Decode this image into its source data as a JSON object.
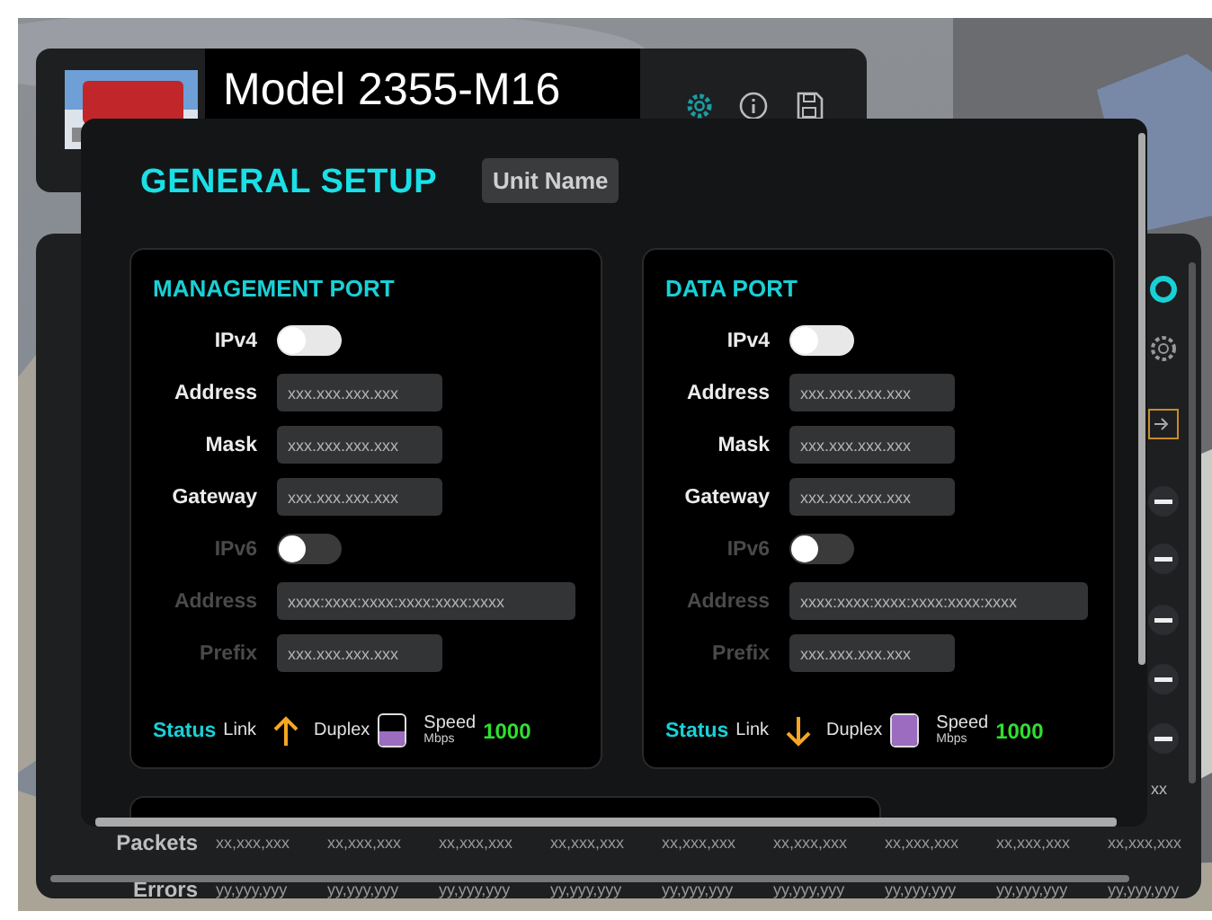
{
  "header": {
    "title": "Model 2355-M16"
  },
  "stats": {
    "rows": [
      {
        "label": "Packets",
        "values": [
          "xx,xxx,xxx",
          "xx,xxx,xxx",
          "xx,xxx,xxx",
          "xx,xxx,xxx",
          "xx,xxx,xxx",
          "xx,xxx,xxx",
          "xx,xxx,xxx",
          "xx,xxx,xxx",
          "xx,xxx,xxx"
        ]
      },
      {
        "label": "Errors",
        "values": [
          "yy,yyy,yyy",
          "yy,yyy,yyy",
          "yy,yyy,yyy",
          "yy,yyy,yyy",
          "yy,yyy,yyy",
          "yy,yyy,yyy",
          "yy,yyy,yyy",
          "yy,yyy,yyy",
          "yy,yyy,yyy"
        ]
      }
    ],
    "overflow_text": "xx"
  },
  "dialog": {
    "title": "GENERAL SETUP",
    "unit_name_button": "Unit Name",
    "ports": [
      {
        "title": "MANAGEMENT PORT",
        "rows": [
          {
            "kind": "toggle",
            "label": "IPv4",
            "on": false,
            "disabled": false
          },
          {
            "kind": "field",
            "label": "Address",
            "placeholder": "xxx.xxx.xxx.xxx",
            "disabled": false,
            "wide": false
          },
          {
            "kind": "field",
            "label": "Mask",
            "placeholder": "xxx.xxx.xxx.xxx",
            "disabled": false,
            "wide": false
          },
          {
            "kind": "field",
            "label": "Gateway",
            "placeholder": "xxx.xxx.xxx.xxx",
            "disabled": false,
            "wide": false
          },
          {
            "kind": "toggle",
            "label": "IPv6",
            "on": false,
            "disabled": true
          },
          {
            "kind": "field",
            "label": "Address",
            "placeholder": "xxxx:xxxx:xxxx:xxxx:xxxx:xxxx",
            "disabled": true,
            "wide": true
          },
          {
            "kind": "field",
            "label": "Prefix",
            "placeholder": "xxx.xxx.xxx.xxx",
            "disabled": true,
            "wide": false
          }
        ],
        "status": {
          "label": "Status",
          "link": {
            "label": "Link",
            "kind": "up"
          },
          "duplex": {
            "label": "Duplex",
            "level": 0.5
          },
          "speed_label": "Speed",
          "speed": "1000",
          "unit": "Mbps"
        }
      },
      {
        "title": "DATA PORT",
        "rows": [
          {
            "kind": "toggle",
            "label": "IPv4",
            "on": false,
            "disabled": false
          },
          {
            "kind": "field",
            "label": "Address",
            "placeholder": "xxx.xxx.xxx.xxx",
            "disabled": false,
            "wide": false
          },
          {
            "kind": "field",
            "label": "Mask",
            "placeholder": "xxx.xxx.xxx.xxx",
            "disabled": false,
            "wide": false
          },
          {
            "kind": "field",
            "label": "Gateway",
            "placeholder": "xxx.xxx.xxx.xxx",
            "disabled": false,
            "wide": false
          },
          {
            "kind": "toggle",
            "label": "IPv6",
            "on": false,
            "disabled": true
          },
          {
            "kind": "field",
            "label": "Address",
            "placeholder": "xxxx:xxxx:xxxx:xxxx:xxxx:xxxx",
            "disabled": true,
            "wide": true
          },
          {
            "kind": "field",
            "label": "Prefix",
            "placeholder": "xxx.xxx.xxx.xxx",
            "disabled": true,
            "wide": false
          }
        ],
        "status": {
          "label": "Status",
          "link": {
            "label": "Link",
            "kind": "down"
          },
          "duplex": {
            "label": "Duplex",
            "level": 1
          },
          "speed_label": "Speed",
          "speed": "1000",
          "unit": "Mbps"
        }
      }
    ]
  }
}
